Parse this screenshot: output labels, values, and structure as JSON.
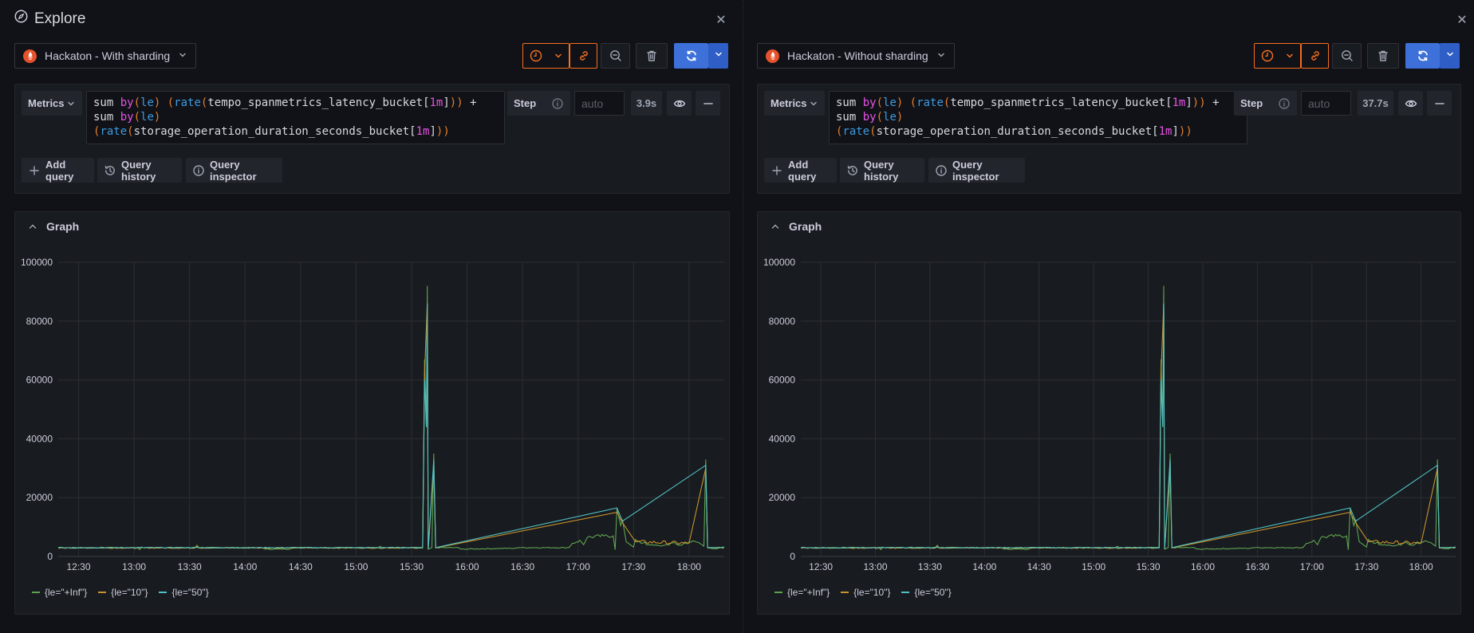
{
  "page": {
    "title": "Explore",
    "icon": "compass-icon"
  },
  "panes": [
    {
      "datasource": "Hackaton - With sharding",
      "query_type": "Metrics",
      "query_lines": [
        [
          [
            "sum ",
            ""
          ],
          [
            "by",
            "by"
          ],
          [
            "(",
            "par"
          ],
          [
            "le",
            "fn"
          ],
          [
            ")",
            "par"
          ],
          [
            " ",
            ""
          ],
          [
            "(",
            "par"
          ],
          [
            "rate",
            "fn"
          ],
          [
            "(",
            "par"
          ],
          [
            "tempo_spanmetrics_latency_bucket[",
            ""
          ],
          [
            "1m",
            "num"
          ],
          [
            "]",
            ""
          ],
          [
            "))",
            "par"
          ],
          [
            " +",
            ""
          ]
        ],
        [
          [
            "sum ",
            ""
          ],
          [
            "by",
            "by"
          ],
          [
            "(",
            "par"
          ],
          [
            "le",
            "fn"
          ],
          [
            ")",
            "par"
          ]
        ],
        [
          [
            "(",
            "par"
          ],
          [
            "rate",
            "fn"
          ],
          [
            "(",
            "par"
          ],
          [
            "storage_operation_duration_seconds_bucket[",
            ""
          ],
          [
            "1m",
            "num"
          ],
          [
            "]",
            ""
          ],
          [
            "))",
            "par"
          ]
        ]
      ],
      "step_label": "Step",
      "step_placeholder": "auto",
      "query_time": "3.9s",
      "buttons": {
        "add_query": "Add query",
        "query_history": "Query history",
        "query_inspector": "Query inspector"
      },
      "graph_title": "Graph"
    },
    {
      "datasource": "Hackaton - Without sharding",
      "query_type": "Metrics",
      "query_lines": [
        [
          [
            "sum ",
            ""
          ],
          [
            "by",
            "by"
          ],
          [
            "(",
            "par"
          ],
          [
            "le",
            "fn"
          ],
          [
            ")",
            "par"
          ],
          [
            " ",
            ""
          ],
          [
            "(",
            "par"
          ],
          [
            "rate",
            "fn"
          ],
          [
            "(",
            "par"
          ],
          [
            "tempo_spanmetrics_latency_bucket[",
            ""
          ],
          [
            "1m",
            "num"
          ],
          [
            "]",
            ""
          ],
          [
            "))",
            "par"
          ],
          [
            " +",
            ""
          ]
        ],
        [
          [
            "sum ",
            ""
          ],
          [
            "by",
            "by"
          ],
          [
            "(",
            "par"
          ],
          [
            "le",
            "fn"
          ],
          [
            ")",
            "par"
          ]
        ],
        [
          [
            "(",
            "par"
          ],
          [
            "rate",
            "fn"
          ],
          [
            "(",
            "par"
          ],
          [
            "storage_operation_duration_seconds_bucket[",
            ""
          ],
          [
            "1m",
            "num"
          ],
          [
            "]",
            ""
          ],
          [
            "))",
            "par"
          ]
        ]
      ],
      "step_label": "Step",
      "step_placeholder": "auto",
      "query_time": "37.7s",
      "buttons": {
        "add_query": "Add query",
        "query_history": "Query history",
        "query_inspector": "Query inspector"
      },
      "graph_title": "Graph"
    }
  ],
  "toolbar_icons": [
    "clock-icon",
    "chevron-down-icon",
    "link-icon",
    "zoom-out-icon",
    "trash-icon",
    "refresh-icon",
    "chevron-down-icon"
  ],
  "colors": {
    "accent_orange": "#f46f20",
    "run_blue": "#3d71d9",
    "series_inf": "#5fa350",
    "series_10": "#c8922e",
    "series_50": "#4fc1c4"
  },
  "chart_data": [
    {
      "type": "line",
      "title": "Graph",
      "xlabel": "",
      "ylabel": "",
      "ylim": [
        0,
        100000
      ],
      "xlim_minutes": [
        "12:19",
        "18:19"
      ],
      "y_ticks": [
        "0",
        "20000",
        "40000",
        "60000",
        "80000",
        "100000"
      ],
      "x_ticks": [
        "12:30",
        "13:00",
        "13:30",
        "14:00",
        "14:30",
        "15:00",
        "15:30",
        "16:00",
        "16:30",
        "17:00",
        "17:30",
        "18:00"
      ],
      "grid": true,
      "legend_position": "bottom-left",
      "series": [
        {
          "name": "{le=\"+Inf\"}",
          "color": "#5fa350",
          "points": [
            [
              "12:19",
              3000
            ],
            [
              "13:02",
              3000
            ],
            [
              "13:03",
              2300
            ],
            [
              "13:04",
              3200
            ],
            [
              "13:05",
              3000
            ],
            [
              "13:33",
              3000
            ],
            [
              "13:34",
              3800
            ],
            [
              "13:35",
              3000
            ],
            [
              "14:09",
              3000
            ],
            [
              "14:11",
              2500
            ],
            [
              "14:24",
              2500
            ],
            [
              "14:26",
              3000
            ],
            [
              "15:12",
              3000
            ],
            [
              "15:13",
              3500
            ],
            [
              "15:14",
              3000
            ],
            [
              "15:36",
              3000
            ],
            [
              "15:37",
              67000
            ],
            [
              "15:38",
              44000
            ],
            [
              "15:38.5",
              92000
            ],
            [
              "15:39",
              2500
            ],
            [
              "15:41",
              3000
            ],
            [
              "15:42",
              35000
            ],
            [
              "15:43",
              3000
            ],
            [
              "15:55",
              3000
            ],
            [
              "15:57",
              2500
            ],
            [
              "16:26",
              2800
            ],
            [
              "16:28",
              3000
            ],
            [
              "16:55",
              3000
            ],
            [
              "16:57",
              4500
            ],
            [
              "17:01",
              5500
            ],
            [
              "17:03",
              4000
            ],
            [
              "17:05",
              6500
            ],
            [
              "17:14",
              7000
            ],
            [
              "17:19",
              7000
            ],
            [
              "17:20",
              2300
            ],
            [
              "17:21",
              16500
            ],
            [
              "17:23",
              10500
            ],
            [
              "17:24",
              12500
            ],
            [
              "17:26",
              5000
            ],
            [
              "17:30",
              3200
            ],
            [
              "17:31",
              5800
            ],
            [
              "17:34",
              4500
            ],
            [
              "17:40",
              4000
            ],
            [
              "17:45",
              3500
            ],
            [
              "17:50",
              4500
            ],
            [
              "17:55",
              3800
            ],
            [
              "18:00",
              5000
            ],
            [
              "18:05",
              4800
            ],
            [
              "18:08",
              3500
            ],
            [
              "18:09",
              33000
            ],
            [
              "18:10",
              3000
            ],
            [
              "18:15",
              2600
            ],
            [
              "18:19",
              3200
            ]
          ]
        },
        {
          "name": "{le=\"10\"}",
          "color": "#c8922e",
          "points": [
            [
              "12:19",
              2900
            ],
            [
              "13:33",
              2900
            ],
            [
              "13:34",
              3500
            ],
            [
              "13:35",
              2900
            ],
            [
              "15:36",
              2900
            ],
            [
              "15:37",
              62000
            ],
            [
              "15:38.5",
              86000
            ],
            [
              "15:39",
              2400
            ],
            [
              "15:42",
              30000
            ],
            [
              "15:43",
              2900
            ],
            [
              "17:21",
              15000
            ],
            [
              "17:24",
              11500
            ],
            [
              "17:31",
              5000
            ],
            [
              "18:00",
              4500
            ],
            [
              "18:09",
              30000
            ],
            [
              "18:10",
              2900
            ],
            [
              "18:19",
              3000
            ]
          ]
        },
        {
          "name": "{le=\"50\"}",
          "color": "#4fc1c4",
          "points": [
            [
              "12:19",
              3000
            ],
            [
              "15:36",
              3000
            ],
            [
              "15:37",
              60000
            ],
            [
              "15:38",
              44000
            ],
            [
              "15:38.5",
              86000
            ],
            [
              "15:39",
              2500
            ],
            [
              "15:42",
              33000
            ],
            [
              "15:43",
              3000
            ],
            [
              "17:21",
              16500
            ],
            [
              "17:24",
              12000
            ],
            [
              "18:09",
              31000
            ],
            [
              "18:10",
              3000
            ],
            [
              "18:19",
              3100
            ]
          ]
        }
      ]
    },
    {
      "type": "line",
      "title": "Graph",
      "xlabel": "",
      "ylabel": "",
      "ylim": [
        0,
        100000
      ],
      "xlim_minutes": [
        "12:19",
        "18:19"
      ],
      "y_ticks": [
        "0",
        "20000",
        "40000",
        "60000",
        "80000",
        "100000"
      ],
      "x_ticks": [
        "12:30",
        "13:00",
        "13:30",
        "14:00",
        "14:30",
        "15:00",
        "15:30",
        "16:00",
        "16:30",
        "17:00",
        "17:30",
        "18:00"
      ],
      "grid": true,
      "legend_position": "bottom-left",
      "series": "same as pane 1"
    }
  ]
}
